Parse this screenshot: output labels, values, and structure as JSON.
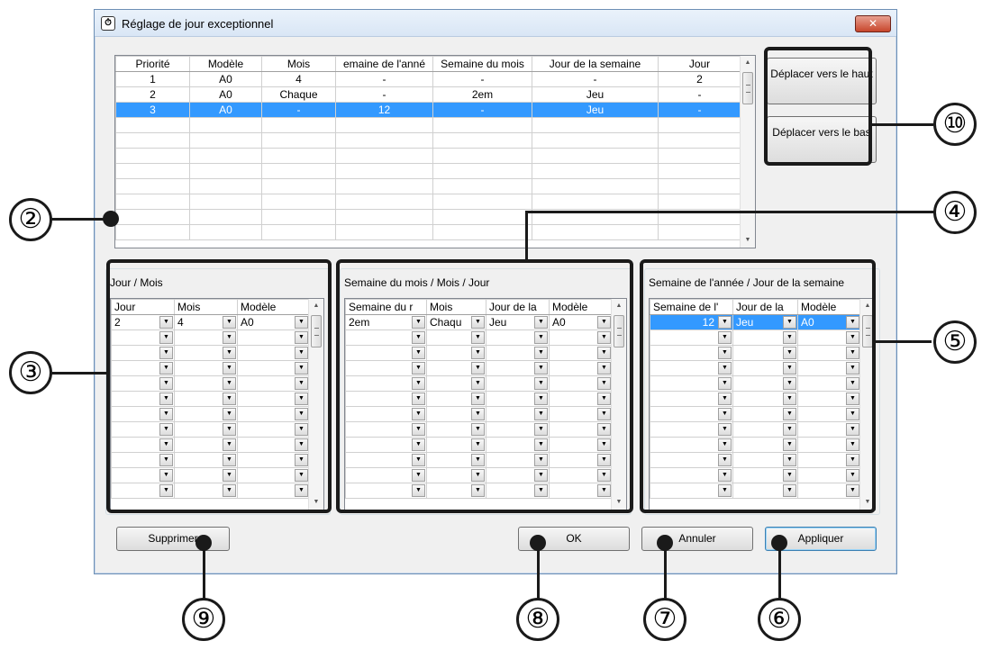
{
  "window": {
    "icon_glyph": "⏱",
    "title": "Réglage de jour exceptionnel",
    "close_glyph": "✕"
  },
  "main_grid": {
    "columns": [
      "Priorité",
      "Modèle",
      "Mois",
      "emaine de l'anné",
      "Semaine du mois",
      "Jour de la semaine",
      "Jour"
    ],
    "rows": [
      [
        "1",
        "A0",
        "4",
        "-",
        "-",
        "-",
        "2"
      ],
      [
        "2",
        "A0",
        "Chaque",
        "-",
        "2em",
        "Jeu",
        "-"
      ],
      [
        "3",
        "A0",
        "-",
        "12",
        "-",
        "Jeu",
        "-"
      ]
    ],
    "selected_row": 3
  },
  "side_buttons": {
    "up_label": "Déplacer vers le haut",
    "down_label": "Déplacer vers le bas"
  },
  "group_day_month": {
    "label": "Jour / Mois",
    "columns": [
      "Jour",
      "Mois",
      "Modèle"
    ],
    "row1": [
      "2",
      "4",
      "A0"
    ]
  },
  "group_week_month": {
    "label": "Semaine du mois / Mois / Jour",
    "columns": [
      "Semaine du r",
      "Mois",
      "Jour de la",
      "Modèle"
    ],
    "row1": [
      "2em",
      "Chaqu",
      "Jeu",
      "A0"
    ]
  },
  "group_week_year": {
    "label": "Semaine de l'année / Jour de la semaine",
    "columns": [
      "Semaine de l'",
      "Jour de la",
      "Modèle"
    ],
    "row1": [
      "12",
      "Jeu",
      "A0"
    ]
  },
  "buttons": {
    "delete": "Supprimer",
    "ok": "OK",
    "cancel": "Annuler",
    "apply": "Appliquer"
  },
  "callouts": {
    "c2": "②",
    "c3": "③",
    "c4": "④",
    "c5": "⑤",
    "c6": "⑥",
    "c7": "⑦",
    "c8": "⑧",
    "c9": "⑨",
    "c10": "⑩"
  },
  "glyphs": {
    "dropdown": "▼",
    "scroll_up": "▲",
    "scroll_down": "▼"
  },
  "colors": {
    "selection": "#3399ff",
    "annotation": "#1a1a1a"
  }
}
